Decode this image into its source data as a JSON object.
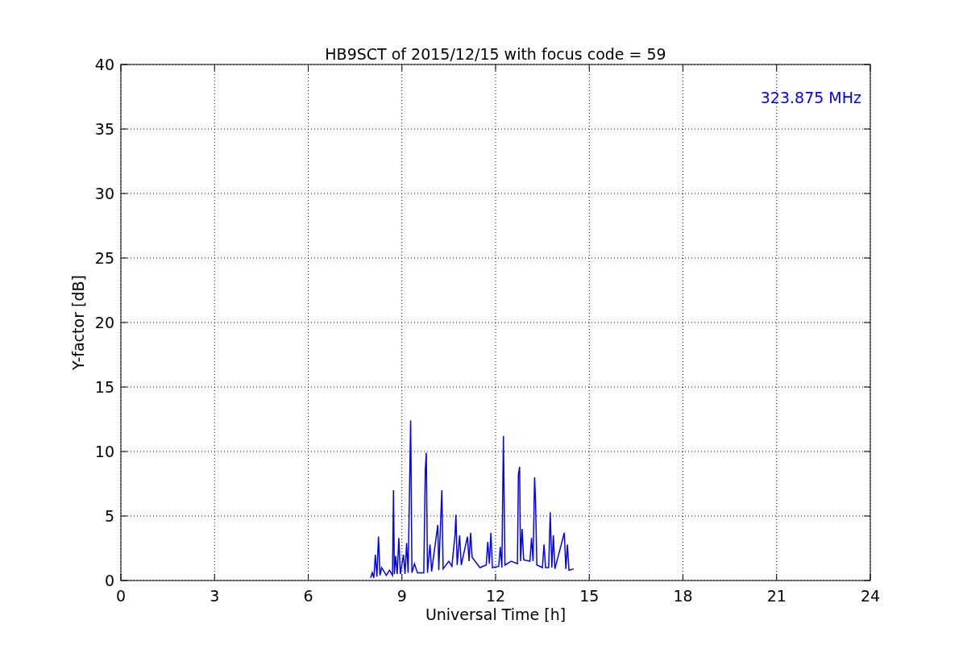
{
  "chart": {
    "chart_data": {
      "type": "line",
      "title": "HB9SCT of 2015/12/15 with focus code = 59",
      "xlabel": "Universal Time [h]",
      "ylabel": "Y-factor [dB]",
      "x": [
        8.0,
        8.05,
        8.1,
        8.15,
        8.2,
        8.25,
        8.3,
        8.35,
        8.5,
        8.6,
        8.7,
        8.73,
        8.76,
        8.8,
        8.85,
        8.9,
        8.95,
        9.05,
        9.1,
        9.15,
        9.2,
        9.28,
        9.32,
        9.4,
        9.5,
        9.7,
        9.75,
        9.78,
        9.82,
        9.9,
        9.95,
        10.15,
        10.18,
        10.28,
        10.32,
        10.5,
        10.6,
        10.7,
        10.73,
        10.77,
        10.85,
        10.9,
        11.1,
        11.15,
        11.2,
        11.25,
        11.5,
        11.7,
        11.75,
        11.8,
        11.85,
        11.9,
        12.1,
        12.15,
        12.2,
        12.25,
        12.3,
        12.5,
        12.7,
        12.73,
        12.77,
        12.8,
        12.85,
        12.9,
        13.1,
        13.15,
        13.2,
        13.25,
        13.28,
        13.32,
        13.5,
        13.55,
        13.6,
        13.7,
        13.75,
        13.8,
        13.85,
        13.9,
        14.2,
        14.25,
        14.3,
        14.35,
        14.5
      ],
      "series": [
        {
          "name": "323.875 MHz",
          "color": "#0000ff",
          "values": [
            0.2,
            0.6,
            0.2,
            2.0,
            0.3,
            3.4,
            0.4,
            1.0,
            0.4,
            0.8,
            0.4,
            7.0,
            0.5,
            1.9,
            0.5,
            3.3,
            0.5,
            2.0,
            0.5,
            2.9,
            0.6,
            12.4,
            0.6,
            1.3,
            0.6,
            0.6,
            8.6,
            9.9,
            0.6,
            2.8,
            0.7,
            4.3,
            0.8,
            7.0,
            0.9,
            1.5,
            1.1,
            3.5,
            5.1,
            1.2,
            3.5,
            1.2,
            3.4,
            1.5,
            3.7,
            1.8,
            1.0,
            1.2,
            3.0,
            1.3,
            3.7,
            1.0,
            1.1,
            2.6,
            1.0,
            11.2,
            1.2,
            1.5,
            1.3,
            8.2,
            8.8,
            1.5,
            4.0,
            1.6,
            1.5,
            3.3,
            1.5,
            8.0,
            6.1,
            1.2,
            1.0,
            2.8,
            1.0,
            1.0,
            5.3,
            1.0,
            3.5,
            0.9,
            3.7,
            0.9,
            2.8,
            0.8,
            0.9
          ]
        }
      ],
      "xlim": [
        0,
        24
      ],
      "ylim": [
        0,
        40
      ],
      "xticks": [
        0,
        3,
        6,
        9,
        12,
        15,
        18,
        21,
        24
      ],
      "yticks": [
        0,
        5,
        10,
        15,
        20,
        25,
        30,
        35,
        40
      ],
      "grid": true
    }
  }
}
